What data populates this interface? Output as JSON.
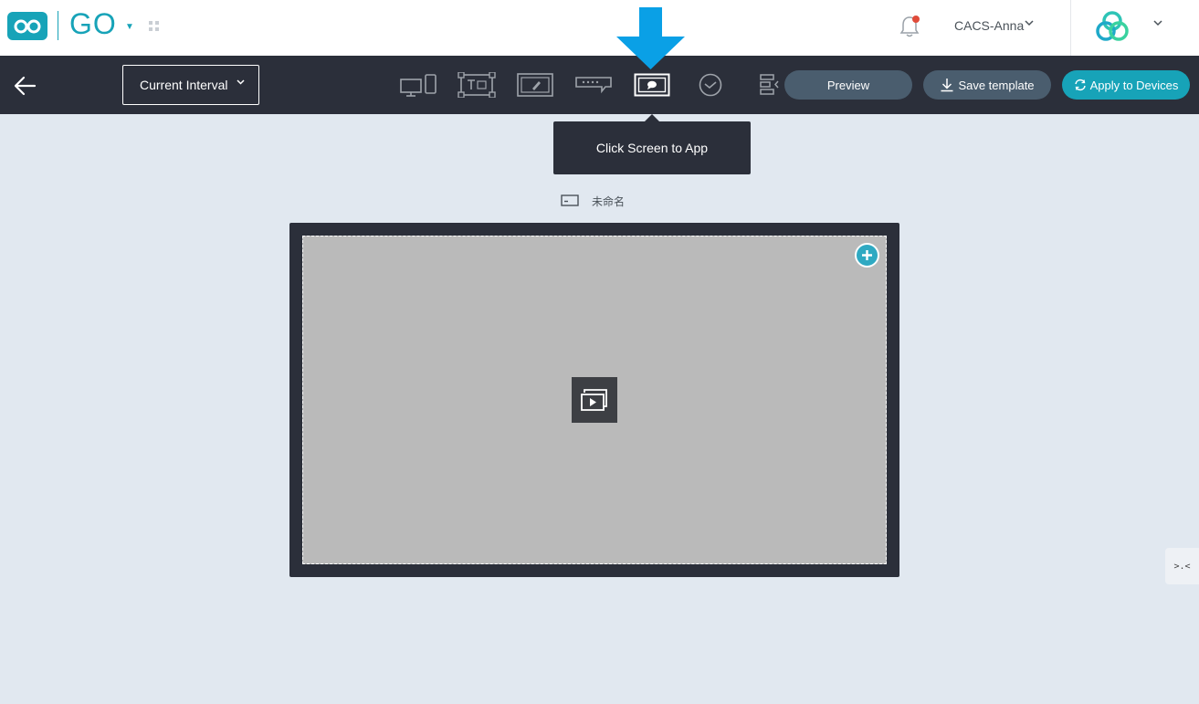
{
  "header": {
    "app_name": "GO",
    "user_name": "CACS-Anna"
  },
  "toolbar": {
    "interval_label": "Current Interval",
    "tools": [
      {
        "name": "devices"
      },
      {
        "name": "text"
      },
      {
        "name": "draw"
      },
      {
        "name": "ticker"
      },
      {
        "name": "screen",
        "active": true
      },
      {
        "name": "clock"
      },
      {
        "name": "align"
      }
    ],
    "preview_label": "Preview",
    "save_label": "Save template",
    "apply_label": "Apply to Devices"
  },
  "tooltip": {
    "text": "Click Screen to App"
  },
  "canvas": {
    "screen_name": "未命名"
  },
  "side_tab": {
    "label": ">.<"
  },
  "colors": {
    "accent": "#17a3b8",
    "toolbar_bg": "#2b2f3a",
    "page_bg": "#e1e8f0",
    "canvas_bg": "#bababa",
    "arrow": "#0aa0e6"
  }
}
